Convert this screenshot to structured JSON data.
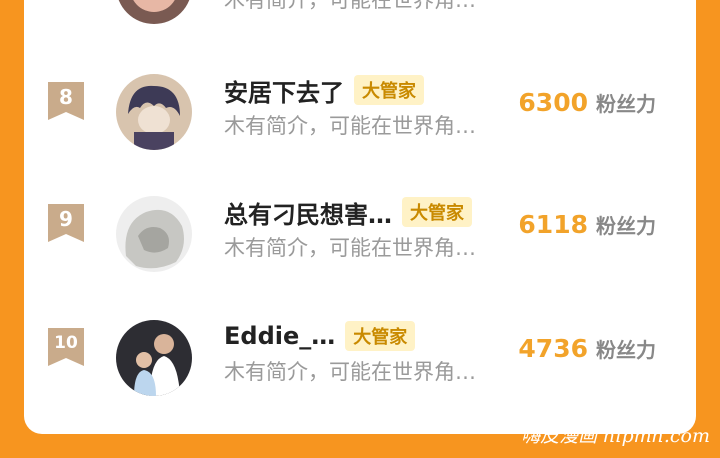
{
  "partial_row": {
    "bio": "木有简介，可能在世界角…"
  },
  "rows": [
    {
      "rank": "8",
      "name": "安居下去了",
      "tag": "大管家",
      "bio": "木有简介，可能在世界角…",
      "score": "6300",
      "unit": "粉丝力"
    },
    {
      "rank": "9",
      "name": "总有刁民想害…",
      "tag": "大管家",
      "bio": "木有简介，可能在世界角…",
      "score": "6118",
      "unit": "粉丝力"
    },
    {
      "rank": "10",
      "name": "Eddie_…",
      "tag": "大管家",
      "bio": "木有简介，可能在世界角…",
      "score": "4736",
      "unit": "粉丝力"
    }
  ],
  "watermark": "嗨皮漫画 hipmh.com",
  "colors": {
    "background": "#f7951f",
    "score": "#f2a32a",
    "badge": "#c9ab8b",
    "tag_bg": "#fff2c6"
  }
}
